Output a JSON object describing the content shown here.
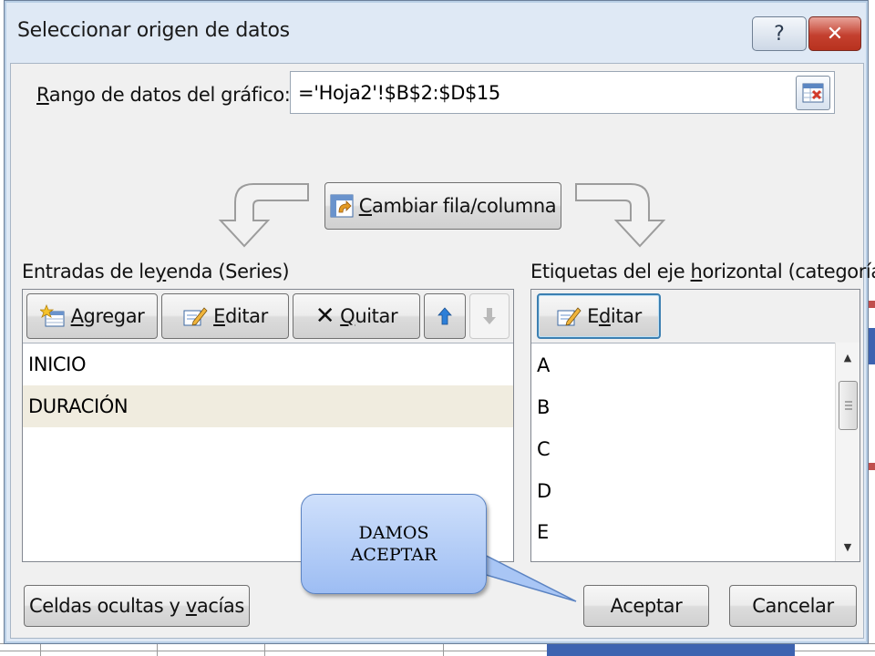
{
  "dialog": {
    "title": "Seleccionar origen de datos",
    "help_label": "?",
    "close_label": "✕"
  },
  "data_range": {
    "label_first": "R",
    "label_rest": "ango de datos del gráfico:",
    "value": "='Hoja2'!$B$2:$D$15"
  },
  "switch_button": {
    "first": "C",
    "rest": "ambiar fila/columna"
  },
  "legend_panel": {
    "title_before": "Entradas de le",
    "title_underlined": "y",
    "title_after": "enda (Series)",
    "add": {
      "first": "A",
      "rest": "gregar"
    },
    "edit": {
      "first": "E",
      "rest": "ditar"
    },
    "remove": {
      "first": "Q",
      "rest": "uitar"
    },
    "series": [
      "INICIO",
      "DURACIÓN"
    ],
    "selected_index": 1
  },
  "axis_panel": {
    "title_before": "Etiquetas del eje ",
    "title_underlined": "h",
    "title_after": "orizontal (categoría)",
    "edit": {
      "before": "E",
      "underlined": "d",
      "after": "itar"
    },
    "categories": [
      "A",
      "B",
      "C",
      "D",
      "E"
    ]
  },
  "hidden_cells_button": {
    "before": "Celdas ocultas y ",
    "underlined": "v",
    "after": "acías"
  },
  "ok_button": "Aceptar",
  "cancel_button": "Cancelar",
  "callout": {
    "line1": "DAMOS",
    "line2": "ACEPTAR"
  },
  "colors": {
    "title_bg": "#dfe9f5",
    "close_red": "#c4402f",
    "selected_row": "#f0ecdf",
    "callout_fill": "#b5cff7",
    "focus_border": "#3c7fb1"
  }
}
